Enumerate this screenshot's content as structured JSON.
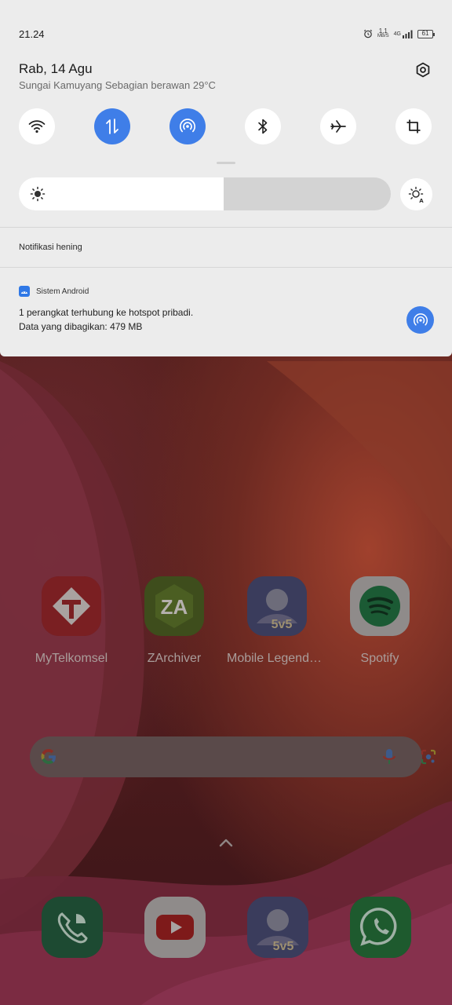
{
  "status_bar": {
    "time": "21.24",
    "net_speed": "1.1",
    "net_speed_unit": "MB/S",
    "network": "4G",
    "battery": "61"
  },
  "header": {
    "date": "Rab, 14 Agu",
    "weather": "Sungai Kamuyang Sebagian berawan 29°C"
  },
  "quick_settings": [
    {
      "name": "wifi",
      "icon": "wifi-icon",
      "active": false
    },
    {
      "name": "mobile-data",
      "icon": "mobile-data-icon",
      "active": true
    },
    {
      "name": "hotspot",
      "icon": "hotspot-icon",
      "active": true
    },
    {
      "name": "bluetooth",
      "icon": "bluetooth-icon",
      "active": false
    },
    {
      "name": "airplane-mode",
      "icon": "airplane-icon",
      "active": false
    },
    {
      "name": "screenshot",
      "icon": "crop-icon",
      "active": false
    }
  ],
  "brightness": {
    "level": 0.55
  },
  "notifications": {
    "section_label": "Notifikasi hening",
    "items": [
      {
        "app_name": "Sistem Android",
        "line1": "1 perangkat terhubung ke hotspot pribadi.",
        "line2": "Data yang dibagikan: 479 MB"
      }
    ]
  },
  "home": {
    "apps": [
      {
        "label": "MyTelkomsel"
      },
      {
        "label": "ZArchiver"
      },
      {
        "label": "Mobile Legends: Bang Bang"
      },
      {
        "label": "Spotify"
      }
    ],
    "dock": [
      "Phone",
      "YouTube",
      "Mobile Legends",
      "WhatsApp"
    ]
  },
  "colors": {
    "accent": "#3f7ee8",
    "shade_bg": "#ececec"
  }
}
